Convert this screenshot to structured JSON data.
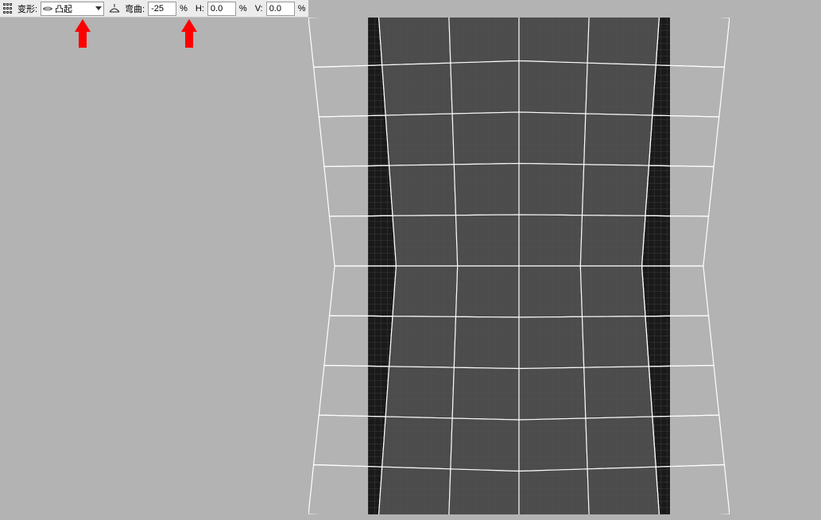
{
  "toolbar": {
    "transform_label": "变形:",
    "transform_dropdown": {
      "selected": "凸起"
    },
    "bend_label": "弯曲:",
    "bend_value": "-25",
    "percent": "%",
    "h_label": "H:",
    "h_value": "0.0",
    "v_label": "V:",
    "v_value": "0.0"
  },
  "annotations": {
    "arrow1_target": "transform-dropdown",
    "arrow2_target": "bend-input"
  },
  "canvas": {
    "warp_type": "bulge",
    "bend_percent": -25,
    "grid_rows": 10,
    "grid_cols": 6
  }
}
